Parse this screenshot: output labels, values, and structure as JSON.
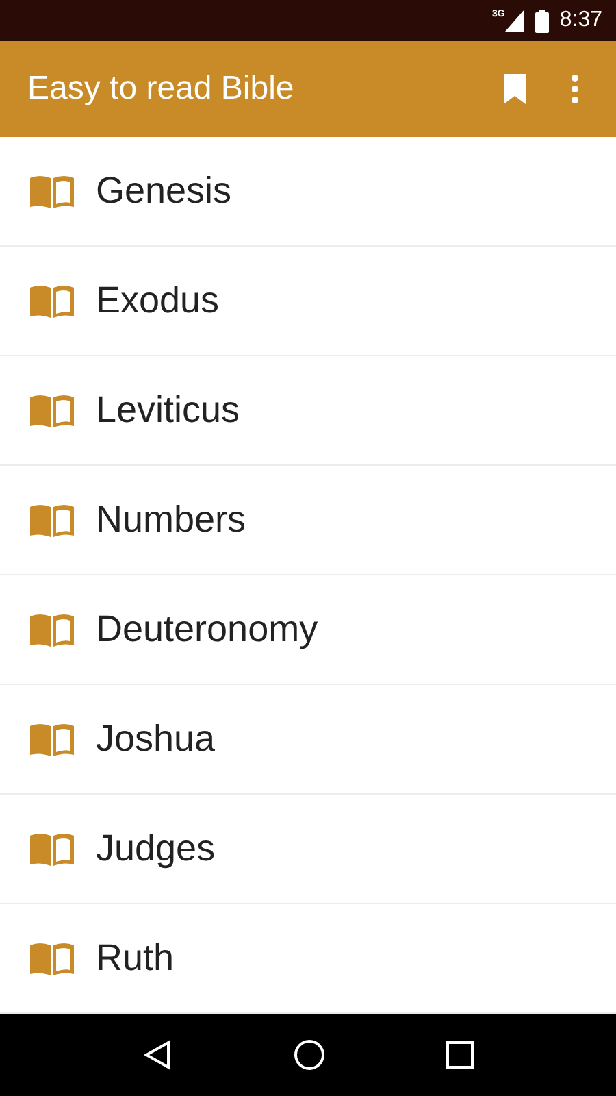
{
  "status_bar": {
    "network": "3G",
    "time": "8:37"
  },
  "app_bar": {
    "title": "Easy to read Bible"
  },
  "books": [
    {
      "name": "Genesis"
    },
    {
      "name": "Exodus"
    },
    {
      "name": "Leviticus"
    },
    {
      "name": "Numbers"
    },
    {
      "name": "Deuteronomy"
    },
    {
      "name": "Joshua"
    },
    {
      "name": "Judges"
    },
    {
      "name": "Ruth"
    }
  ]
}
